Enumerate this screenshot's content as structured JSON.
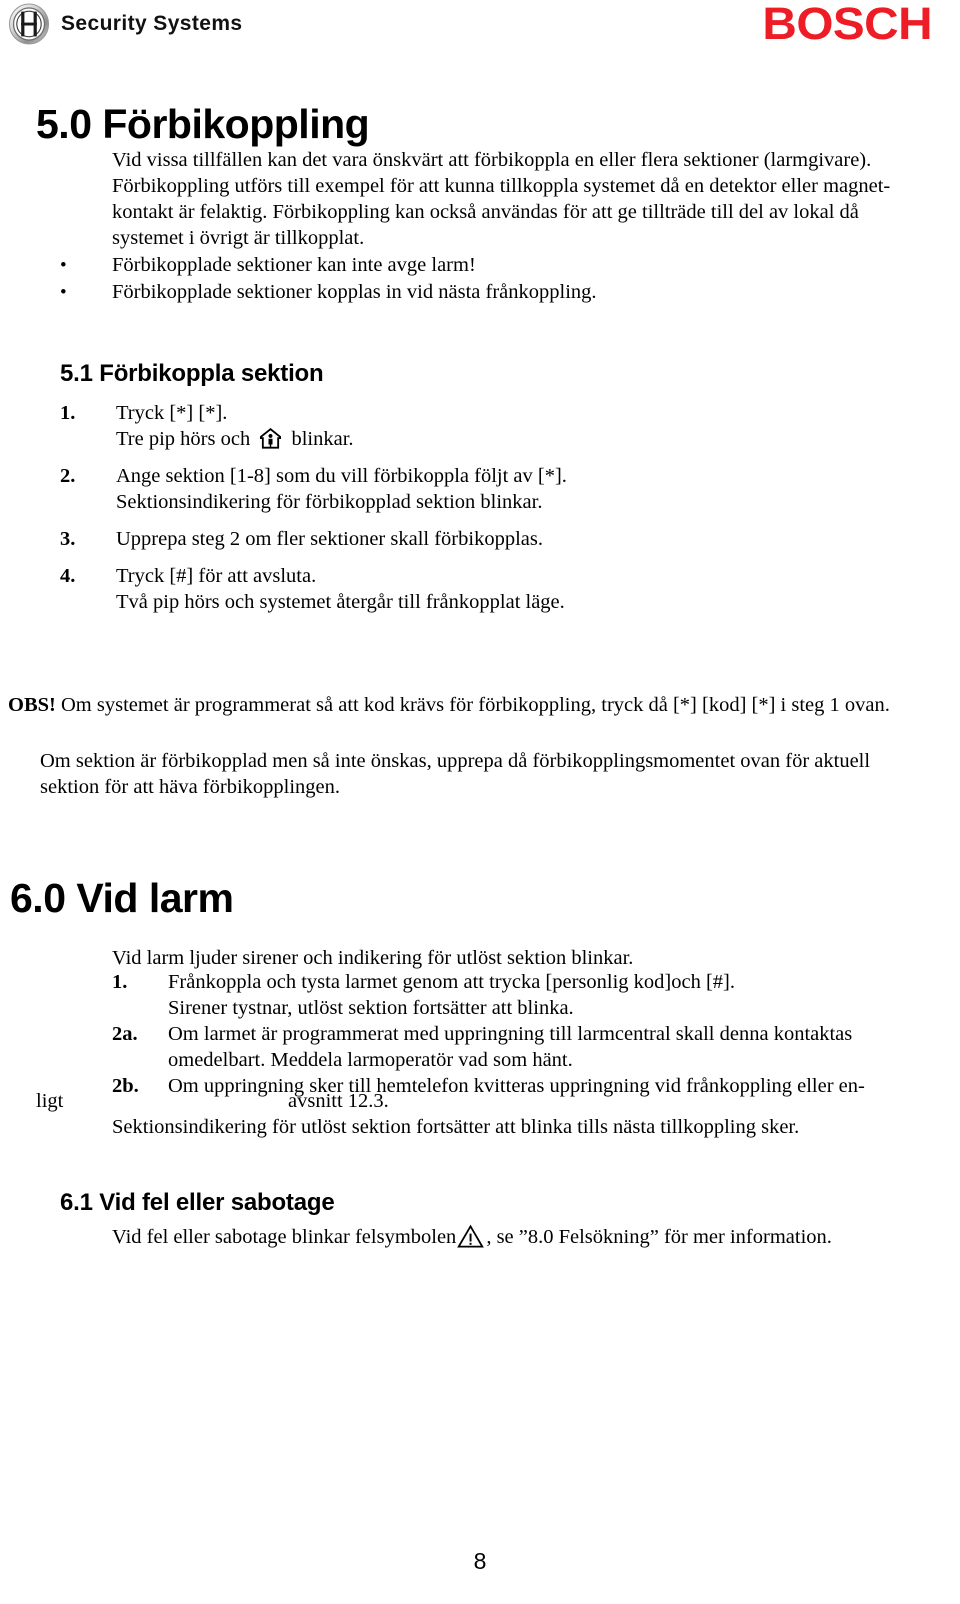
{
  "header": {
    "logo_icon": "bosch-oval-logo-icon",
    "brand_text": "Security Systems",
    "wordmark": "BOSCH",
    "wordmark_color": "#ee1c25"
  },
  "sections": {
    "s50": {
      "title": "5.0 Förbikoppling",
      "intro_lines": [
        "Vid vissa tillfällen kan det vara önskvärt att förbikoppla en eller flera sektioner (larmgivare).",
        "Förbikoppling utförs till exempel för att kunna tillkoppla systemet då en detektor eller magnet-",
        "kontakt är felaktig. Förbikoppling kan också användas för att ge tillträde till del av lokal då",
        "systemet i övrigt är tillkopplat."
      ],
      "bullet_marker": "•",
      "bullets": [
        "Förbikopplade sektioner kan inte avge larm!",
        "Förbikopplade sektioner kopplas in vid nästa frånkoppling."
      ]
    },
    "s51": {
      "title": "5.1 Förbikoppla sektion",
      "steps": [
        {
          "num": "1.",
          "lines": [
            {
              "text": "Tryck [*] [*]."
            },
            {
              "pre": "Tre pip hörs och ",
              "icon": "home-person-icon",
              "post": " blinkar."
            }
          ]
        },
        {
          "num": "2.",
          "lines": [
            {
              "text": "Ange sektion [1-8] som du vill förbikoppla följt av [*]."
            },
            {
              "text": "Sektionsindikering för förbikopplad sektion blinkar."
            }
          ]
        },
        {
          "num": "3.",
          "lines": [
            {
              "text": "Upprepa steg 2 om fler sektioner skall förbikopplas."
            }
          ]
        },
        {
          "num": "4.",
          "lines": [
            {
              "text": "Tryck [#] för att avsluta."
            },
            {
              "text": "Två pip hörs och systemet återgår till frånkopplat läge."
            }
          ]
        }
      ],
      "note_label": "OBS!",
      "note_text": " Om systemet är programmerat så att kod krävs för förbikoppling, tryck då [*] [kod] [*] i steg 1 ovan.",
      "closing_lines": [
        "Om sektion är förbikopplad men så inte önskas, upprepa då förbikopplingsmomentet ovan för aktuell",
        "sektion för att häva förbikopplingen."
      ]
    },
    "s60": {
      "title": "6.0 Vid larm",
      "intro": "Vid larm ljuder sirener och indikering för utlöst sektion blinkar.",
      "steps": [
        {
          "num": "1.",
          "lines": [
            {
              "text": "Frånkoppla och tysta larmet genom att trycka [personlig kod]och [#]."
            },
            {
              "text": "Sirener tystnar, utlöst sektion fortsätter att blinka."
            }
          ]
        },
        {
          "num": "2a.",
          "lines": [
            {
              "text": "Om larmet är programmerat med uppringning till larmcentral skall denna kontaktas"
            },
            {
              "text": "omedelbart. Meddela larmoperatör vad som hänt."
            }
          ]
        },
        {
          "num": "2b.",
          "lines": [
            {
              "text": "Om  uppringning sker till hemtelefon kvitteras uppringning vid frånkoppling eller en-"
            }
          ]
        }
      ],
      "stray_fragment": "ligt",
      "centered_fragment": "avsnitt 12.3.",
      "trailing_line": "Sektionsindikering för utlöst sektion fortsätter att blinka tills nästa tillkoppling sker."
    },
    "s61": {
      "title": "6.1 Vid fel eller sabotage",
      "line_pre": "Vid fel eller sabotage blinkar felsymbolen",
      "warning_icon": "warning-triangle-icon",
      "line_post": ", se ”8.0 Felsökning” för mer information."
    }
  },
  "footer": {
    "page_number": "8"
  }
}
